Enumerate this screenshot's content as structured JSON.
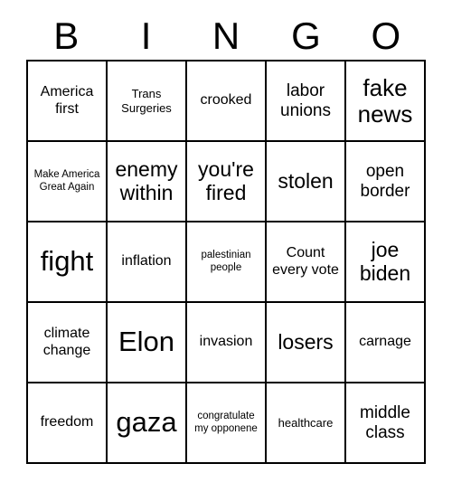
{
  "card": {
    "header_letters": [
      "B",
      "I",
      "N",
      "G",
      "O"
    ],
    "rows": [
      [
        {
          "text": "America first",
          "size": "md"
        },
        {
          "text": "Trans Surgeries",
          "size": "sm"
        },
        {
          "text": "crooked",
          "size": "md"
        },
        {
          "text": "labor unions",
          "size": "lg"
        },
        {
          "text": "fake news",
          "size": "xxl"
        }
      ],
      [
        {
          "text": "Make America Great Again",
          "size": "xs"
        },
        {
          "text": "enemy within",
          "size": "xl"
        },
        {
          "text": "you're fired",
          "size": "xl"
        },
        {
          "text": "stolen",
          "size": "xl"
        },
        {
          "text": "open border",
          "size": "lg"
        }
      ],
      [
        {
          "text": "fight",
          "size": "huge"
        },
        {
          "text": "inflation",
          "size": "md"
        },
        {
          "text": "palestinian people",
          "size": "xs"
        },
        {
          "text": "Count every vote",
          "size": "md"
        },
        {
          "text": "joe biden",
          "size": "xl"
        }
      ],
      [
        {
          "text": "climate change",
          "size": "md"
        },
        {
          "text": "Elon",
          "size": "huge"
        },
        {
          "text": "invasion",
          "size": "md"
        },
        {
          "text": "losers",
          "size": "xl"
        },
        {
          "text": "carnage",
          "size": "md"
        }
      ],
      [
        {
          "text": "freedom",
          "size": "md"
        },
        {
          "text": "gaza",
          "size": "huge"
        },
        {
          "text": "congratulate my opponene",
          "size": "xs"
        },
        {
          "text": "healthcare",
          "size": "sm"
        },
        {
          "text": "middle class",
          "size": "lg"
        }
      ]
    ]
  },
  "colors": {
    "grid_line": "#000000",
    "text": "#000000",
    "background": "#ffffff"
  }
}
